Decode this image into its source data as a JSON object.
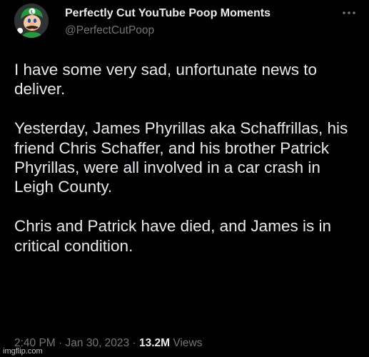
{
  "author": {
    "display_name": "Perfectly Cut YouTube Poop Moments",
    "handle": "@PerfectCutPoop",
    "avatar_icon": "luigi-avatar-icon"
  },
  "more_icon": "ellipsis-icon",
  "tweet": {
    "paragraphs": [
      "I have some very sad, unfortunate news to deliver.",
      "Yesterday, James Phyrillas aka Schaffrillas, his friend Chris Schaffer, and his brother Patrick Phyrillas, were all involved in a car crash in Leigh County.",
      "Chris and Patrick have died, and James is in critical condition."
    ]
  },
  "meta": {
    "time": "2:40 PM",
    "separator": "·",
    "date": "Jan 30, 2023",
    "views_count": "13.2M",
    "views_label": "Views"
  },
  "watermark": "imgflip.com",
  "colors": {
    "background": "#000000",
    "primary_text": "#e7e9ea",
    "secondary_text": "#71767b"
  }
}
